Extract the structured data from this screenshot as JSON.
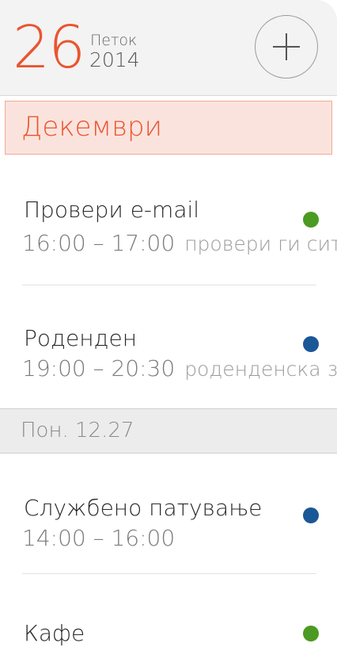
{
  "header": {
    "day": "26",
    "weekday": "Петок",
    "year": "2014",
    "add_icon": "plus-icon"
  },
  "month": "Декември",
  "events_group1": [
    {
      "title": "Провери e-mail",
      "time": "16:00 – 17:00",
      "note": "провери ги сите",
      "color": "#4b9a22"
    },
    {
      "title": "Роденден",
      "time": "19:00 – 20:30",
      "note": "роденденска забава",
      "color": "#1a5797"
    }
  ],
  "day_band": "Пон. 12.27",
  "events_group2": [
    {
      "title": "Службено патување",
      "time": "14:00 – 16:00",
      "note": "",
      "color": "#1a5797"
    },
    {
      "title": "Кафе",
      "time": "",
      "note": "",
      "color": "#4b9a22"
    }
  ]
}
